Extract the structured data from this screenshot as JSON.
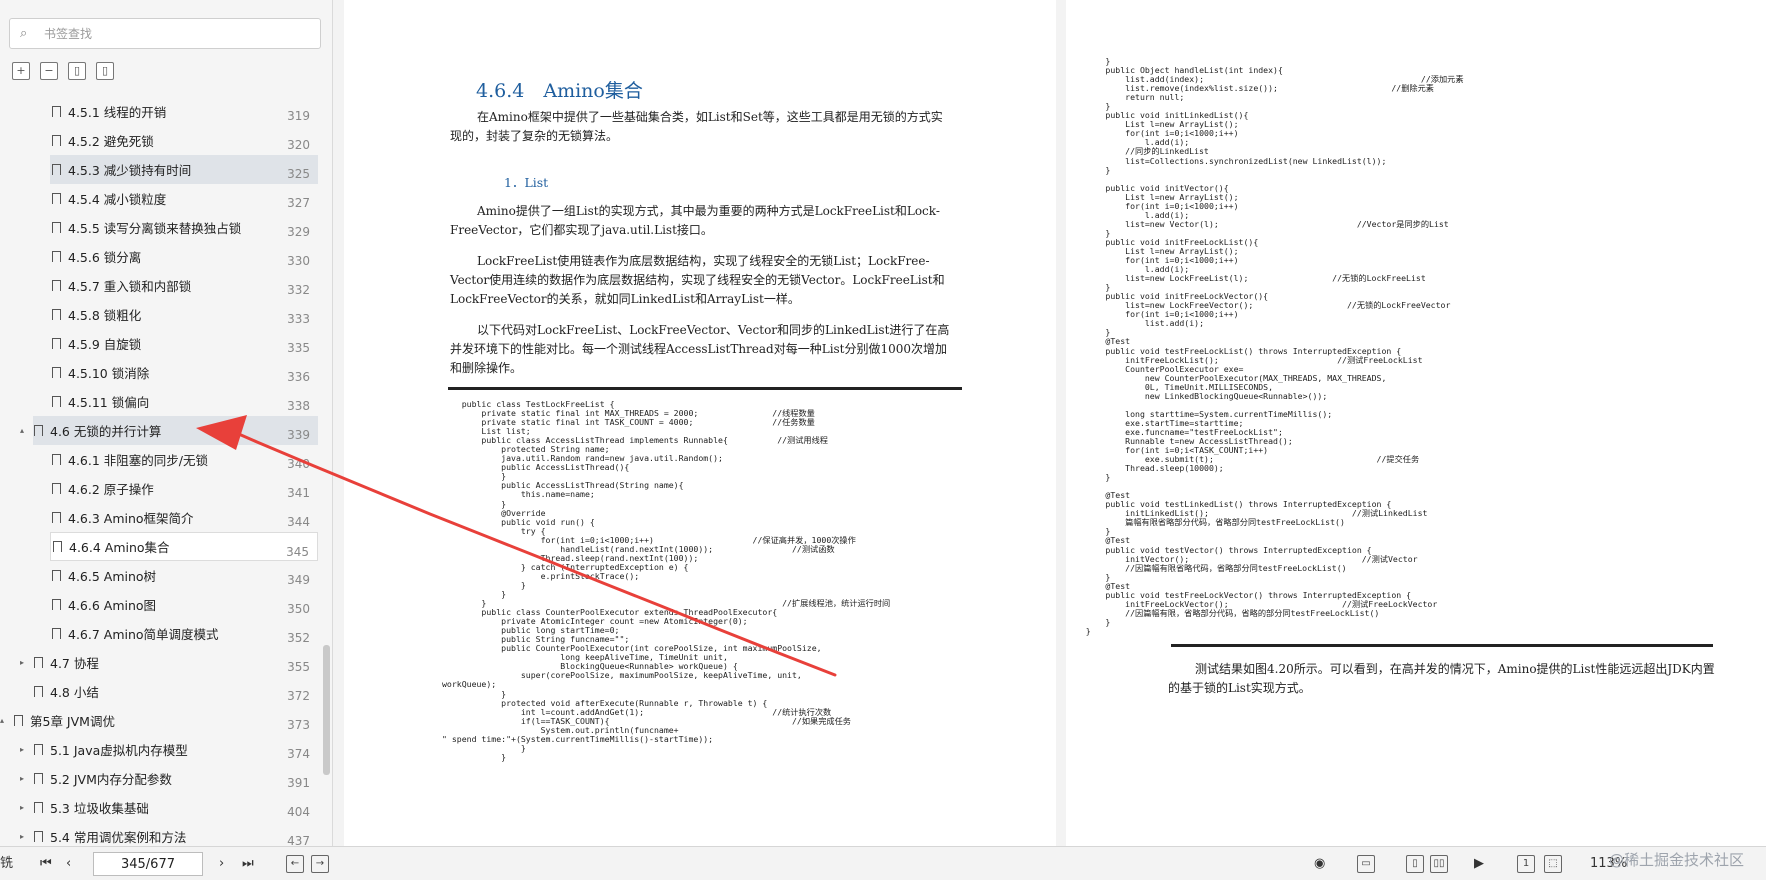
{
  "sidebar": {
    "search_placeholder": "书签查找",
    "toc": [
      {
        "label": "4.5.1 线程的开销",
        "page": "319",
        "level": 3,
        "state": ""
      },
      {
        "label": "4.5.2 避免死锁",
        "page": "320",
        "level": 3,
        "state": ""
      },
      {
        "label": "4.5.3 减少锁持有时间",
        "page": "325",
        "level": 3,
        "state": "hl"
      },
      {
        "label": "4.5.4 减小锁粒度",
        "page": "327",
        "level": 3,
        "state": ""
      },
      {
        "label": "4.5.5 读写分离锁来替换独占锁",
        "page": "329",
        "level": 3,
        "state": ""
      },
      {
        "label": "4.5.6 锁分离",
        "page": "330",
        "level": 3,
        "state": ""
      },
      {
        "label": "4.5.7 重入锁和内部锁",
        "page": "332",
        "level": 3,
        "state": ""
      },
      {
        "label": "4.5.8 锁粗化",
        "page": "333",
        "level": 3,
        "state": ""
      },
      {
        "label": "4.5.9 自旋锁",
        "page": "335",
        "level": 3,
        "state": ""
      },
      {
        "label": "4.5.10 锁消除",
        "page": "336",
        "level": 3,
        "state": ""
      },
      {
        "label": "4.5.11 锁偏向",
        "page": "338",
        "level": 3,
        "state": ""
      },
      {
        "label": "4.6 无锁的并行计算",
        "page": "339",
        "level": 2,
        "state": "hl",
        "arrow": "▴"
      },
      {
        "label": "4.6.1 非阻塞的同步/无锁",
        "page": "340",
        "level": 3,
        "state": ""
      },
      {
        "label": "4.6.2 原子操作",
        "page": "341",
        "level": 3,
        "state": ""
      },
      {
        "label": "4.6.3 Amino框架简介",
        "page": "344",
        "level": 3,
        "state": ""
      },
      {
        "label": "4.6.4 Amino集合",
        "page": "345",
        "level": 3,
        "state": "sel"
      },
      {
        "label": "4.6.5 Amino树",
        "page": "349",
        "level": 3,
        "state": ""
      },
      {
        "label": "4.6.6 Amino图",
        "page": "350",
        "level": 3,
        "state": ""
      },
      {
        "label": "4.6.7 Amino简单调度模式",
        "page": "352",
        "level": 3,
        "state": ""
      },
      {
        "label": "4.7 协程",
        "page": "355",
        "level": 2,
        "state": "",
        "arrow": "▸"
      },
      {
        "label": "4.8 小结",
        "page": "372",
        "level": 2,
        "state": ""
      },
      {
        "label": "第5章 JVM调优",
        "page": "373",
        "level": 1,
        "state": "",
        "arrow": "▴"
      },
      {
        "label": "5.1 Java虚拟机内存模型",
        "page": "374",
        "level": 2,
        "state": "",
        "arrow": "▸"
      },
      {
        "label": "5.2 JVM内存分配参数",
        "page": "391",
        "level": 2,
        "state": "",
        "arrow": "▸"
      },
      {
        "label": "5.3 垃圾收集基础",
        "page": "404",
        "level": 2,
        "state": "",
        "arrow": "▸"
      },
      {
        "label": "5.4 常用调优案例和方法",
        "page": "437",
        "level": 2,
        "state": "",
        "arrow": "▸"
      }
    ]
  },
  "left_page": {
    "section_title": "4.6.4　Amino集合",
    "intro": "在Amino框架中提供了一些基础集合类，如List和Set等，这些工具都是用无锁的方式实现的，封装了复杂的无锁算法。",
    "subhead": "1．List",
    "p1": "Amino提供了一组List的实现方式，其中最为重要的两种方式是LockFreeList和Lock-FreeVector，它们都实现了java.util.List接口。",
    "p2": "LockFreeList使用链表作为底层数据结构，实现了线程安全的无锁List；LockFree-Vector使用连续的数据作为底层数据结构，实现了线程安全的无锁Vector。LockFreeList和LockFreeVector的关系，就如同LinkedList和ArrayList一样。",
    "p3": "以下代码对LockFreeList、LockFreeVector、Vector和同步的LinkedList进行了在高并发环境下的性能对比。每一个测试线程AccessListThread对每一种List分别做1000次增加和删除操作。",
    "code": "    public class TestLockFreeList {\n        private static final int MAX_THREADS = 2000;               //线程数量\n        private static final int TASK_COUNT = 4000;                //任务数量\n        List list;\n        public class AccessListThread implements Runnable{          //测试用线程\n            protected String name;\n            java.util.Random rand=new java.util.Random();\n            public AccessListThread(){\n            }\n            public AccessListThread(String name){\n                this.name=name;\n            }\n            @Override\n            public void run() {\n                try {\n                    for(int i=0;i<1000;i++)                    //保证高并发，1000次操作\n                        handleList(rand.nextInt(1000));                //测试函数\n                    Thread.sleep(rand.nextInt(100));\n                } catch (InterruptedException e) {\n                    e.printStackTrace();\n                }\n            }\n        }                                                            //扩展线程池，统计运行时间\n        public class CounterPoolExecutor extends ThreadPoolExecutor{\n            private AtomicInteger count =new AtomicInteger(0);\n            public long startTime=0;\n            public String funcname=\"\";\n            public CounterPoolExecutor(int corePoolSize, int maximumPoolSize,\n                        long keepAliveTime, TimeUnit unit,\n                        BlockingQueue<Runnable> workQueue) {\n                super(corePoolSize, maximumPoolSize, keepAliveTime, unit,\nworkQueue);\n            }\n            protected void afterExecute(Runnable r, Throwable t) {\n                int l=count.addAndGet(1);                          //统计执行次数\n                if(l==TASK_COUNT){                                     //如果完成任务\n                    System.out.println(funcname+\n\" spend time:\"+(System.currentTimeMillis()-startTime));\n                }\n            }"
  },
  "right_page": {
    "code": "        }\n        public Object handleList(int index){\n            list.add(index);                                            //添加元素\n            list.remove(index%list.size());                       //删除元素\n            return null;\n        }\n        public void initLinkedList(){\n            List l=new ArrayList();\n            for(int i=0;i<1000;i++)\n                l.add(i);\n            //同步的LinkedList\n            list=Collections.synchronizedList(new LinkedList(l));\n        }\n\n        public void initVector(){\n            List l=new ArrayList();\n            for(int i=0;i<1000;i++)\n                l.add(i);\n            list=new Vector(l);                            //Vector是同步的List\n        }\n        public void initFreeLockList(){\n            List l=new ArrayList();\n            for(int i=0;i<1000;i++)\n                l.add(i);\n            list=new LockFreeList(l);                 //无锁的LockFreeList\n        }\n        public void initFreeLockVector(){\n            list=new LockFreeVector();                   //无锁的LockFreeVector\n            for(int i=0;i<1000;i++)\n                list.add(i);\n        }\n        @Test\n        public void testFreeLockList() throws InterruptedException {\n            initFreeLockList();                        //测试FreeLockList\n            CounterPoolExecutor exe=\n                new CounterPoolExecutor(MAX_THREADS, MAX_THREADS,\n                0L, TimeUnit.MILLISECONDS,\n                new LinkedBlockingQueue<Runnable>());\n\n            long starttime=System.currentTimeMillis();\n            exe.startTime=starttime;\n            exe.funcname=\"testFreeLockList\";\n            Runnable t=new AccessListThread();\n            for(int i=0;i<TASK_COUNT;i++)\n                exe.submit(t);                                 //提交任务\n            Thread.sleep(10000);\n        }\n\n        @Test\n        public void testLinkedList() throws InterruptedException {\n            initLinkedList();                             //测试LinkedList\n            篇幅有限省略部分代码，省略部分同testFreeLockList()\n        }\n        @Test\n        public void testVector() throws InterruptedException {\n            initVector();                                   //测试Vector\n            //因篇幅有限省略代码，省略部分同testFreeLockList()\n        }\n        @Test\n        public void testFreeLockVector() throws InterruptedException {\n            initFreeLockVector();                       //测试FreeLockVector\n            //因篇幅有限，省略部分代码，省略的部分同testFreeLockList()\n        }\n    }",
    "result": "测试结果如图4.20所示。可以看到，在高并发的情况下，Amino提供的List性能远远超出JDK内置的基于锁的List实现方式。"
  },
  "bottom_bar": {
    "left_label": "铣",
    "page_input": "345/677",
    "zoom": "113%",
    "watermark": "@稀土掘金技术社区"
  },
  "colors": {
    "accent": "#1f5e9e",
    "annotation_arrow": "#e8403a",
    "highlight_row": "#dfe3e8"
  }
}
